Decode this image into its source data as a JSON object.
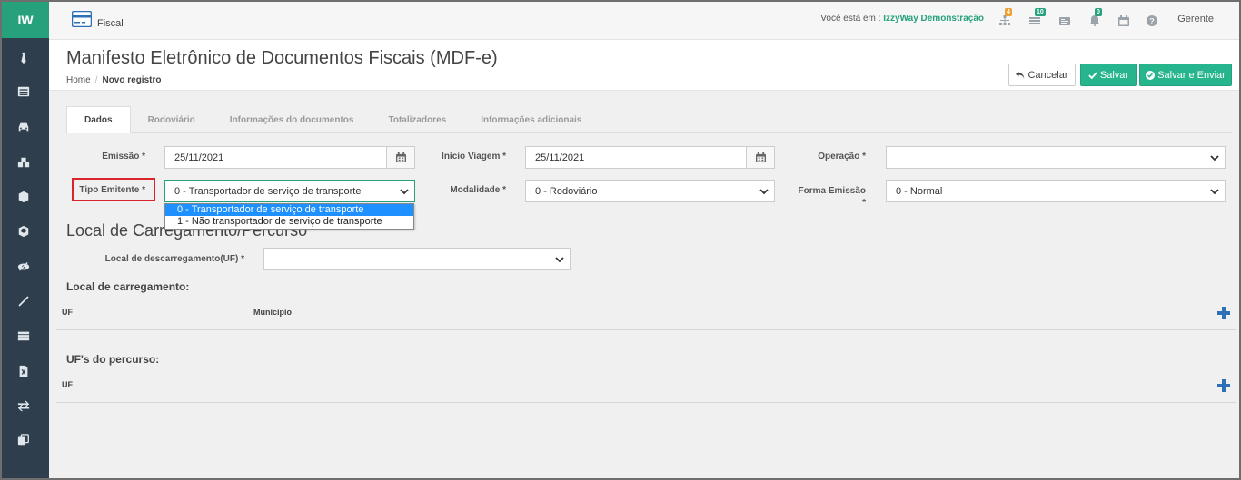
{
  "sidebar": {
    "logo": "IW",
    "icons": [
      "tie-icon",
      "list-icon",
      "car-icon",
      "boxes-icon",
      "cube-icon",
      "cubes-icon",
      "eye-slash-icon",
      "wand-icon",
      "table-icon",
      "file-excel-icon",
      "exchange-icon",
      "copy-icon"
    ]
  },
  "topbar": {
    "module": "Fiscal",
    "env_prefix": "Você está em :",
    "env_name": "IzzyWay Demonstração",
    "badges": {
      "sitemap": "4",
      "grid": "10",
      "bell": "0"
    },
    "user": "Gerente"
  },
  "header": {
    "title": "Manifesto Eletrônico de Documentos Fiscais (MDF-e)",
    "breadcrumb_home": "Home",
    "breadcrumb_sep": "/",
    "breadcrumb_current": "Novo registro",
    "btn_cancel": "Cancelar",
    "btn_save": "Salvar",
    "btn_save_send": "Salvar e Enviar"
  },
  "tabs": [
    "Dados",
    "Rodoviário",
    "Informações do documentos",
    "Totalizadores",
    "Informações adicionais"
  ],
  "form": {
    "emissao_label": "Emissão *",
    "emissao_value": "25/11/2021",
    "inicio_label": "Início Viagem *",
    "inicio_value": "25/11/2021",
    "operacao_label": "Operação *",
    "operacao_value": "",
    "tipo_label": "Tipo Emitente *",
    "tipo_value": "0 - Transportador de serviço de transporte",
    "modalidade_label": "Modalidade *",
    "modalidade_value": "0 - Rodoviário",
    "forma_label_1": "Forma Emissão",
    "forma_label_2": "*",
    "forma_value": "0 - Normal"
  },
  "dropdown_options": [
    "0 - Transportador de serviço de transporte",
    "1 - Não transportador de serviço de transporte"
  ],
  "local": {
    "section_title": "Local de Carregamento/Percurso",
    "descarregamento_label": "Local de descarregamento(UF) *",
    "descarregamento_value": "",
    "carregamento_title": "Local de carregamento:",
    "col_uf": "UF",
    "col_municipio": "Município",
    "percurso_title": "UF's do percurso:",
    "col_uf_percurso": "UF"
  },
  "colors": {
    "accent": "#26b58c",
    "sidebar": "#2f3e4d",
    "logo": "#26a17c",
    "plus": "#2f6fb5",
    "highlight_border": "#d9242b"
  }
}
